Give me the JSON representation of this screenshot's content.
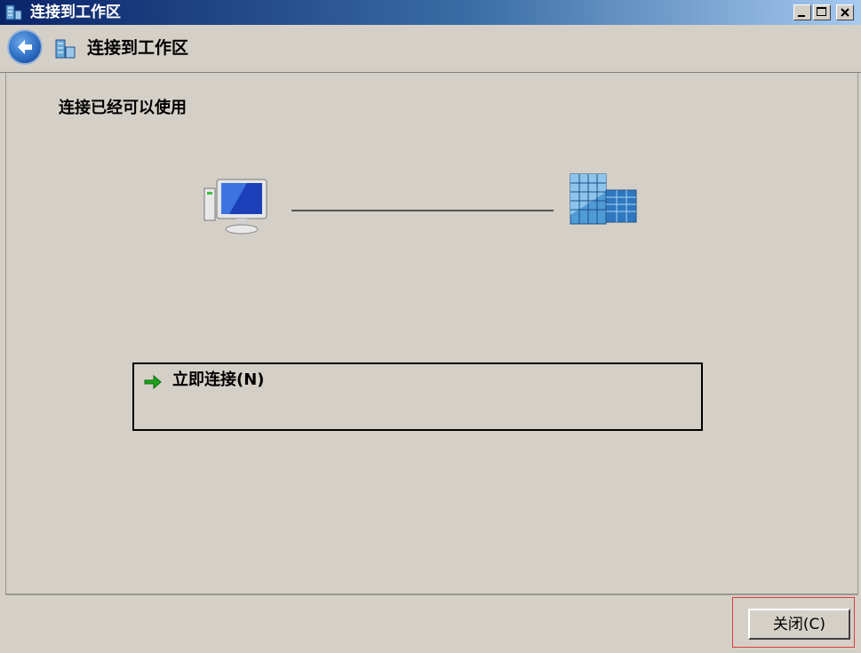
{
  "window": {
    "title": "连接到工作区",
    "controls": [
      "minimize",
      "maximize",
      "close"
    ]
  },
  "nav": {
    "back_icon": "back-arrow-icon",
    "icon": "workspace-icon",
    "title": "连接到工作区"
  },
  "main": {
    "status_heading": "连接已经可以使用",
    "computer_icon": "computer-icon",
    "workspace_icon": "office-building-icon",
    "connect_now_label": "立即连接(N)",
    "connect_arrow_icon": "green-arrow-icon"
  },
  "footer": {
    "close_label": "关闭(C)"
  },
  "colors": {
    "titlebar_start": "#0a246a",
    "titlebar_end": "#a6caf0",
    "background": "#d4d0c8",
    "focus_frame": "#e03b3b",
    "arrow": "#1aa31a"
  }
}
